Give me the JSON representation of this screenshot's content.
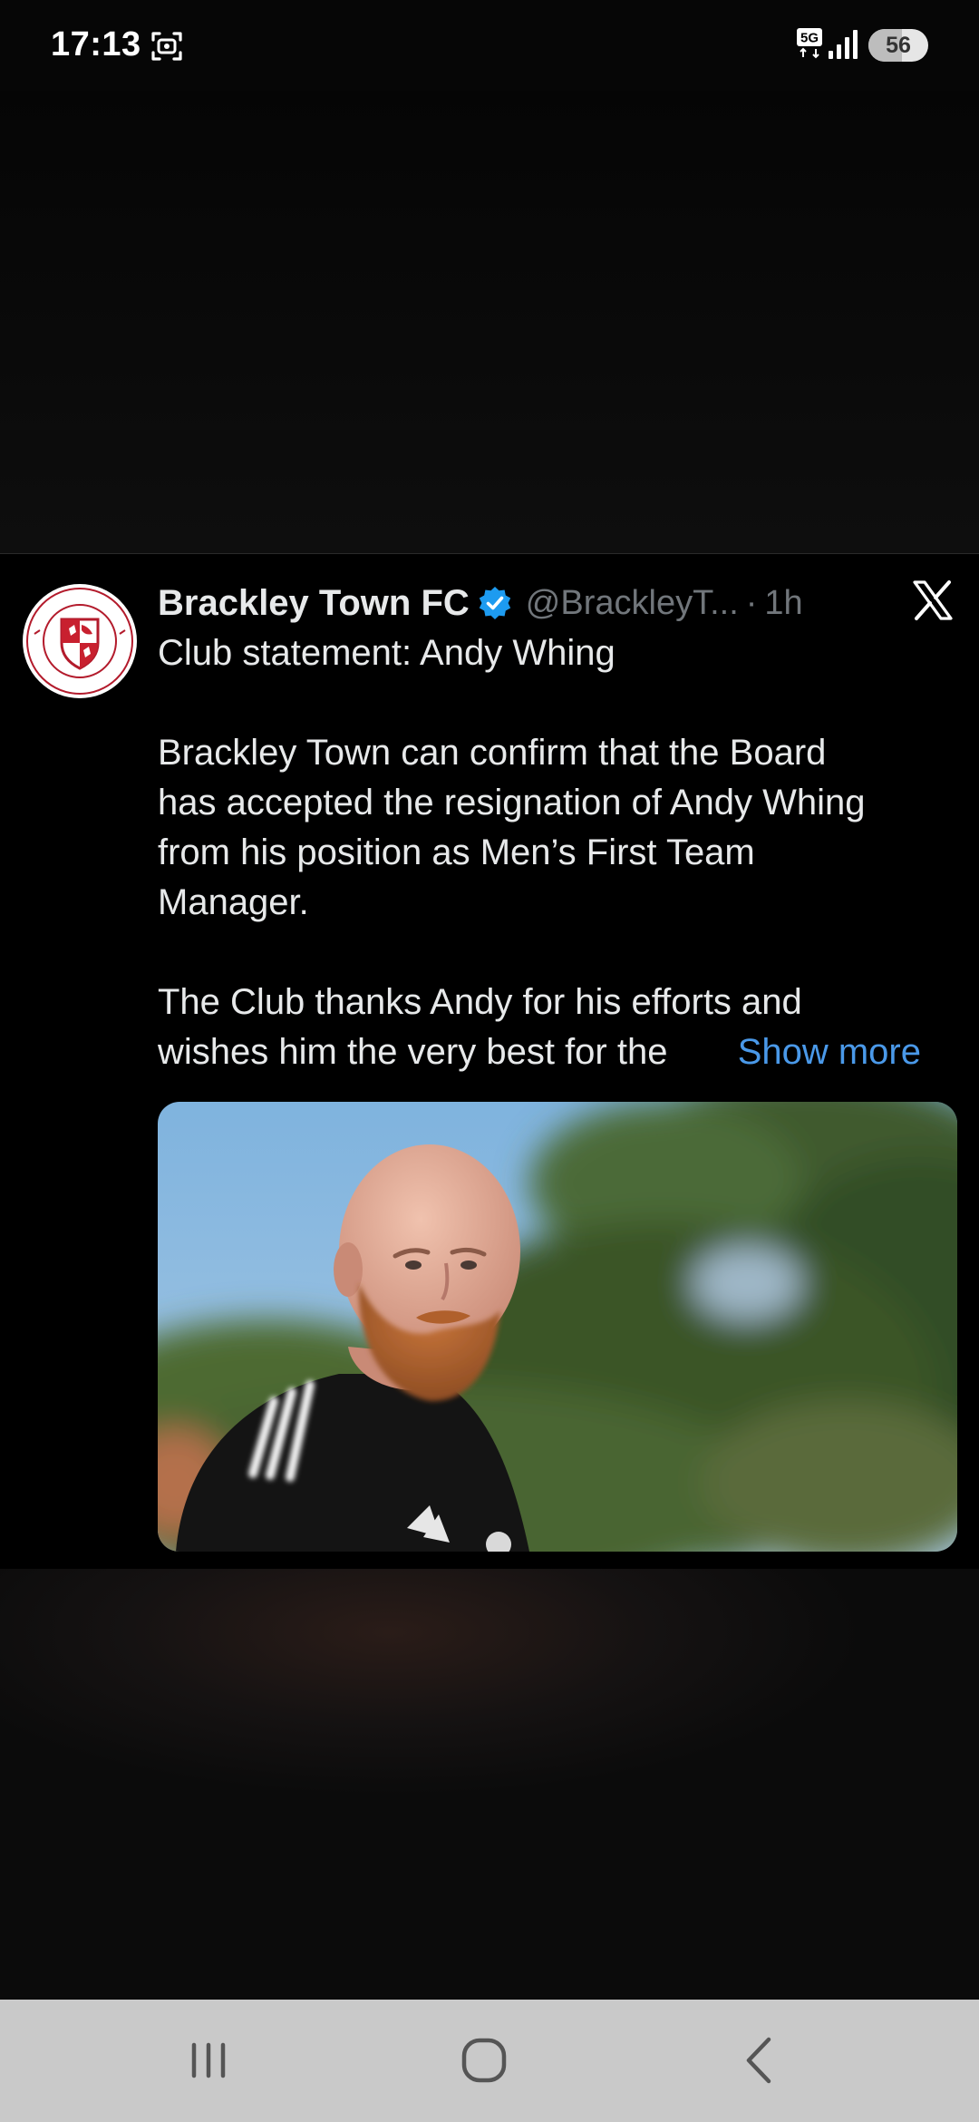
{
  "status_bar": {
    "time": "17:13",
    "network_label": "5G",
    "battery_level": "56",
    "battery_fraction": 0.56,
    "icons": [
      "screenshot-icon",
      "network-5g-icon",
      "signal-icon",
      "battery-icon"
    ]
  },
  "tweet": {
    "author_name": "Brackley Town FC",
    "handle": "@BrackleyT...",
    "separator": "·",
    "age": "1h",
    "verified_color": "#1d9bf0",
    "title_line": "Club statement: Andy Whing",
    "paragraph_lines": [
      "Brackley Town can confirm that the Board",
      "has accepted the resignation of Andy Whing",
      "from his position as Men’s First Team",
      "Manager."
    ],
    "paragraph2_lines": [
      "The Club thanks Andy for his efforts and",
      "wishes him the very best for the"
    ],
    "show_more": "Show more",
    "show_more_color": "#4a99e9",
    "media_alt": "photo"
  },
  "nav_bar": {
    "icons": [
      "recent-apps-icon",
      "home-icon",
      "back-icon"
    ]
  },
  "colors": {
    "background": "#060606",
    "card": "#000000",
    "text": "#e7e9ea",
    "muted": "#71767b",
    "nav_bar": "#c9c9c9"
  }
}
